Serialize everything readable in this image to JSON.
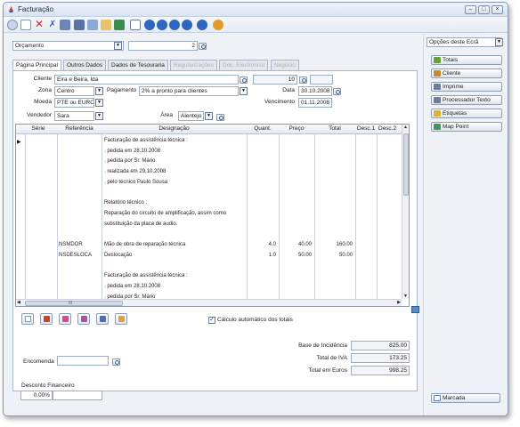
{
  "window": {
    "title": "Facturação"
  },
  "header": {
    "doc_type": "Orçamento",
    "doc_number": "2",
    "side_select": "Opções deste Ecrã"
  },
  "tabs": [
    {
      "label": "Página Principal"
    },
    {
      "label": "Outros Dados"
    },
    {
      "label": "Dados de Tesouraria"
    },
    {
      "label": "Regularizações"
    },
    {
      "label": "Doc. Electrónico"
    },
    {
      "label": "Negócio"
    }
  ],
  "form": {
    "cliente_label": "Cliente",
    "cliente_value": "Eira e Beira, lda",
    "cliente_num": "10",
    "zona_label": "Zona",
    "zona_value": "Centro",
    "pagamento_label": "Pagamento",
    "pagamento_value": "2% a pronto para clientes",
    "data_label": "Data",
    "data_value": "30.10.2008",
    "moeda_label": "Moeda",
    "moeda_value": "PTE ou EURO",
    "vencimento_label": "Vencimento",
    "vencimento_value": "01.11.2008",
    "vendedor_label": "Vendedor",
    "vendedor_value": "Sara",
    "area_label": "Área",
    "area_value": "Alentejo"
  },
  "grid": {
    "columns": [
      "Série",
      "Referência",
      "Designação",
      "Quant.",
      "Preço",
      "Total",
      "Desc.1",
      "Desc.2"
    ],
    "rows": [
      {
        "ref": "",
        "desig": "Facturação de assistência técnica :",
        "qty": "",
        "price": "",
        "total": ""
      },
      {
        "ref": "",
        "desig": ". pedida em 28.10.2008",
        "qty": "",
        "price": "",
        "total": ""
      },
      {
        "ref": "",
        "desig": ". pedida por Sr. Mário",
        "qty": "",
        "price": "",
        "total": ""
      },
      {
        "ref": "",
        "desig": ". realizada em 29.10.2008",
        "qty": "",
        "price": "",
        "total": ""
      },
      {
        "ref": "",
        "desig": ". pelo técnico Paulo Sousa",
        "qty": "",
        "price": "",
        "total": ""
      },
      {
        "ref": "",
        "desig": "",
        "qty": "",
        "price": "",
        "total": ""
      },
      {
        "ref": "",
        "desig": "Relatório técnico :",
        "qty": "",
        "price": "",
        "total": ""
      },
      {
        "ref": "",
        "desig": "Reparação do circuito de amplificação, assim como",
        "qty": "",
        "price": "",
        "total": ""
      },
      {
        "ref": "",
        "desig": "substituição da placa de audio.",
        "qty": "",
        "price": "",
        "total": ""
      },
      {
        "ref": "",
        "desig": "",
        "qty": "",
        "price": "",
        "total": ""
      },
      {
        "ref": "NSMDOR",
        "desig": "Mão de obra de reparação técnica",
        "qty": "4.0",
        "price": "40.00",
        "total": "160.00"
      },
      {
        "ref": "NSDESLOCA",
        "desig": "Deslocação",
        "qty": "1.0",
        "price": "50.00",
        "total": "50.00"
      },
      {
        "ref": "",
        "desig": "",
        "qty": "",
        "price": "",
        "total": ""
      },
      {
        "ref": "",
        "desig": "Facturação de assistência técnica :",
        "qty": "",
        "price": "",
        "total": ""
      },
      {
        "ref": "",
        "desig": ". pedida em 28.10.2008",
        "qty": "",
        "price": "",
        "total": ""
      },
      {
        "ref": "",
        "desig": ". pedida por Sr. Mário",
        "qty": "",
        "price": "",
        "total": ""
      }
    ],
    "scroll_label": "III"
  },
  "auto_calc": {
    "label": "Cálculo automático dos totais",
    "checked": true
  },
  "totals": {
    "base_label": "Base de Incidência",
    "base_value": "825.00",
    "iva_label": "Total de IVA",
    "iva_value": "173.25",
    "euros_label": "Total em Euros",
    "euros_value": "998.25"
  },
  "encomenda": {
    "label": "Encomenda",
    "value": ""
  },
  "desconto": {
    "label": "Desconto Financeiro",
    "value": "0.00%"
  },
  "side_buttons": [
    {
      "label": "Totais",
      "icon": "totals-icon",
      "color": "#6a9e3a"
    },
    {
      "label": "Cliente",
      "icon": "client-icon",
      "color": "#c98a2d"
    },
    {
      "label": "Imprime",
      "icon": "print-icon",
      "color": "#6d7f98"
    },
    {
      "label": "Processador Texto",
      "icon": "text-processor-icon",
      "color": "#6d7f98"
    },
    {
      "label": "Etiquetas",
      "icon": "labels-icon",
      "color": "#d9b23a"
    },
    {
      "label": "Map Point",
      "icon": "map-point-icon",
      "color": "#4c8f58"
    }
  ],
  "marcada": {
    "label": "Marcada"
  }
}
